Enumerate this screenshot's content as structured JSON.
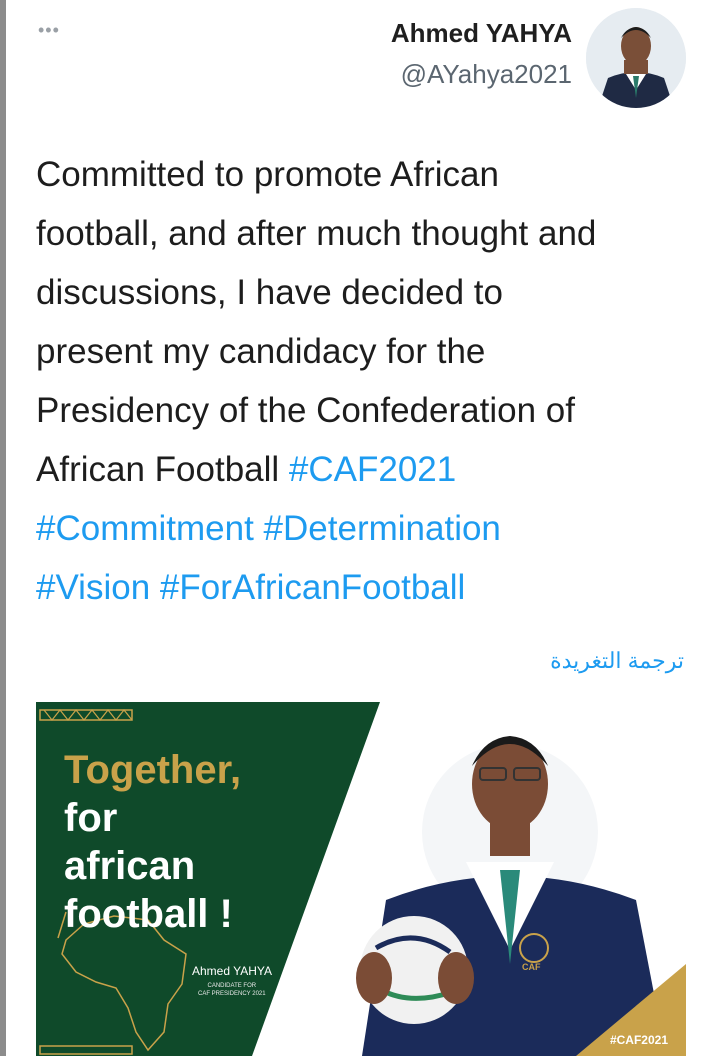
{
  "header": {
    "more_label": "•••",
    "display_name": "Ahmed YAHYA",
    "handle": "@AYahya2021"
  },
  "tweet": {
    "lines": [
      {
        "text": "Committed to promote African",
        "hashtag": ""
      },
      {
        "text": "football, and after much thought and",
        "hashtag": ""
      },
      {
        "text": "discussions, I have decided to",
        "hashtag": ""
      },
      {
        "text": "present my candidacy for the",
        "hashtag": ""
      },
      {
        "text": "Presidency of the Confederation of",
        "hashtag": ""
      },
      {
        "text": "African Football ",
        "hashtag": "#CAF2021"
      },
      {
        "text": "",
        "hashtag": "#Commitment #Determination"
      },
      {
        "text": "",
        "hashtag": "#Vision #ForAfricanFootball"
      }
    ],
    "translate_label": "ترجمة التغريدة"
  },
  "media": {
    "title_line1": "Together,",
    "title_line2": "for",
    "title_line3": "african",
    "title_line4": "football !",
    "poster_name": "Ahmed YAHYA",
    "poster_sub_line1": "CANDIDATE FOR",
    "poster_sub_line2": "CAF PRESIDENCY 2021",
    "badge": "#CAF2021",
    "ball_logo": "CAF"
  },
  "colors": {
    "hashtag": "#1d9bf0",
    "poster_green": "#0f4a2a",
    "gold": "#c9a24a"
  }
}
